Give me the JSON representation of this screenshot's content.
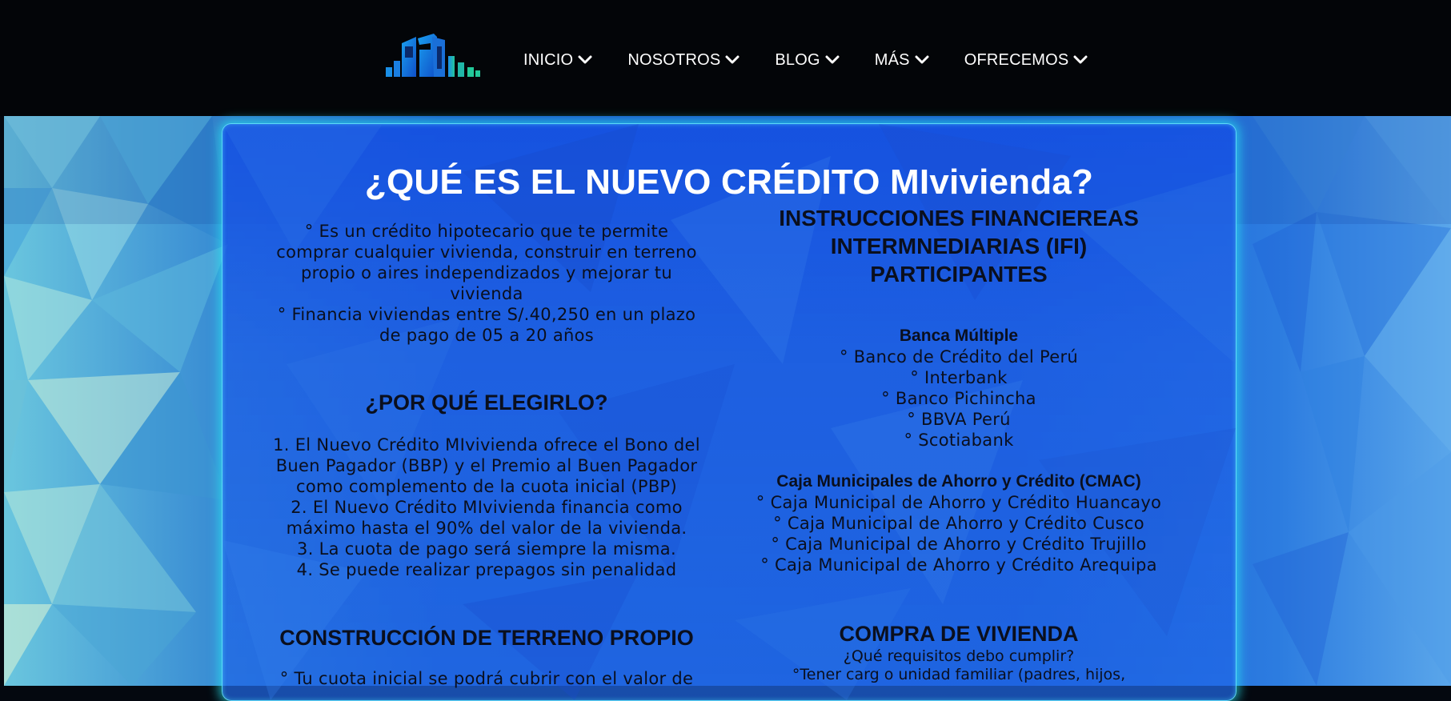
{
  "nav": {
    "items": [
      {
        "label": "INICIO"
      },
      {
        "label": "NOSOTROS"
      },
      {
        "label": "BLOG"
      },
      {
        "label": "MÁS"
      },
      {
        "label": "OFRECEMOS"
      }
    ]
  },
  "card": {
    "title": "¿QUÉ ES EL NUEVO CRÉDITO MIvivienda?",
    "intro_lines": [
      "° Es un crédito hipotecario que te permite",
      "comprar cualquier vivienda, construir en terreno",
      "propio o aires independizados y mejorar tu",
      "vivienda",
      "° Financia viviendas entre S/.40,250 en un plazo",
      "de pago de 05 a 20 años"
    ],
    "why_title": "¿POR QUÉ ELEGIRLO?",
    "why_lines": [
      "1. El Nuevo Crédito MIvivienda ofrece el Bono del",
      "Buen Pagador (BBP) y el Premio al Buen Pagador",
      "como complemento de la cuota inicial (PBP)",
      "2. El Nuevo Crédito MIvivienda financia como",
      "máximo hasta el 90% del valor de la vivienda.",
      "3. La cuota de pago será siempre la misma.",
      "4. Se puede realizar prepagos sin penalidad"
    ],
    "construction_title": "CONSTRUCCIÓN DE TERRENO PROPIO",
    "construction_lines": [
      "° Tu cuota inicial se podrá cubrir con el valor de"
    ],
    "ifi_title_lines": [
      "INSTRUCCIONES FINANCIEREAS",
      "INTERMNEDIARIAS (IFI)",
      "PARTICIPANTES"
    ],
    "banca_title": "Banca Múltiple",
    "banca_items": [
      "° Banco de Crédito del Perú",
      "° Interbank",
      "° Banco Pichincha",
      "° BBVA Perú",
      "° Scotiabank"
    ],
    "cmac_title": "Caja Municipales de Ahorro y Crédito (CMAC)",
    "cmac_items": [
      "° Caja Municipal de Ahorro y Crédito Huancayo",
      "° Caja Municipal de Ahorro y Crédito Cusco",
      "° Caja Municipal de Ahorro y Crédito Trujillo",
      "° Caja Municipal de Ahorro y Crédito Arequipa"
    ],
    "purchase_title": "COMPRA DE VIVIENDA",
    "purchase_question": "¿Qué requisitos debo cumplir?",
    "purchase_lines": [
      "°Tener carg o unidad familiar (padres, hijos,"
    ]
  },
  "colors": {
    "nav_bg": "#030508",
    "nav_text": "#ffffff",
    "card_glow": "#28e6f0",
    "card_bg": "#1652e2",
    "body_text": "#0a0f1e"
  }
}
